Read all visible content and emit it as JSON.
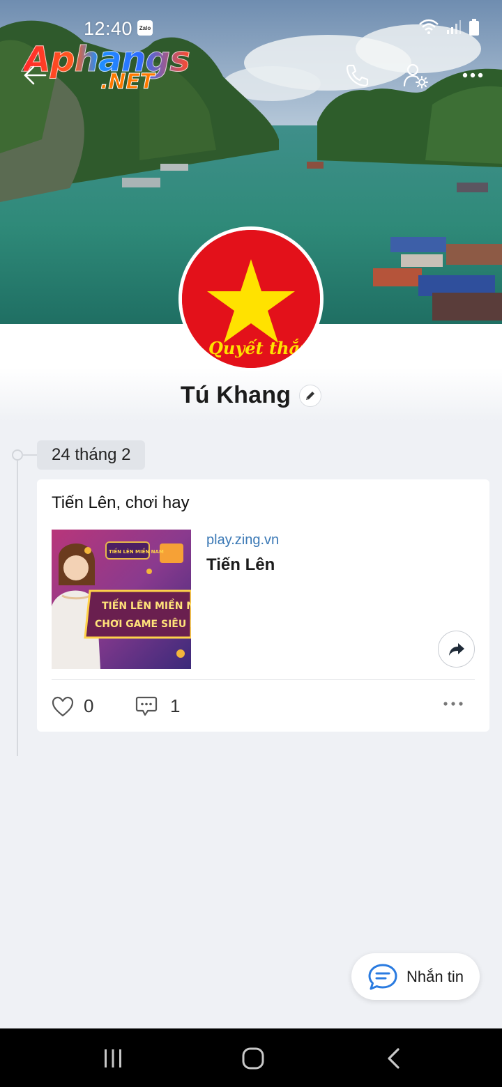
{
  "status_bar": {
    "time": "12:40",
    "zalo_badge": "Zalo"
  },
  "watermark": {
    "line1": "Aphangs",
    "line2": ".NET"
  },
  "header": {
    "back_icon": "arrow-left-icon",
    "call_icon": "phone-icon",
    "settings_icon": "user-settings-icon",
    "more_icon": "more-horizontal-icon"
  },
  "profile": {
    "name": "Tú Khang",
    "avatar_caption": "Quyết thắng"
  },
  "timeline": {
    "date_label": "24 tháng 2",
    "post": {
      "text": "Tiến Lên, chơi hay",
      "link_domain": "play.zing.vn",
      "link_title": "Tiến Lên",
      "thumb_lines": [
        "TIẾN LÊN MIỀN N",
        "CHƠI GAME SIÊU N"
      ],
      "thumb_logo": "TIẾN LÊN MIỀN NAM",
      "likes": "0",
      "comments": "1"
    }
  },
  "message_button": {
    "label": "Nhắn tin"
  },
  "colors": {
    "accent": "#3a78b5",
    "flag_red": "#e3111a",
    "flag_star": "#ffe200"
  }
}
